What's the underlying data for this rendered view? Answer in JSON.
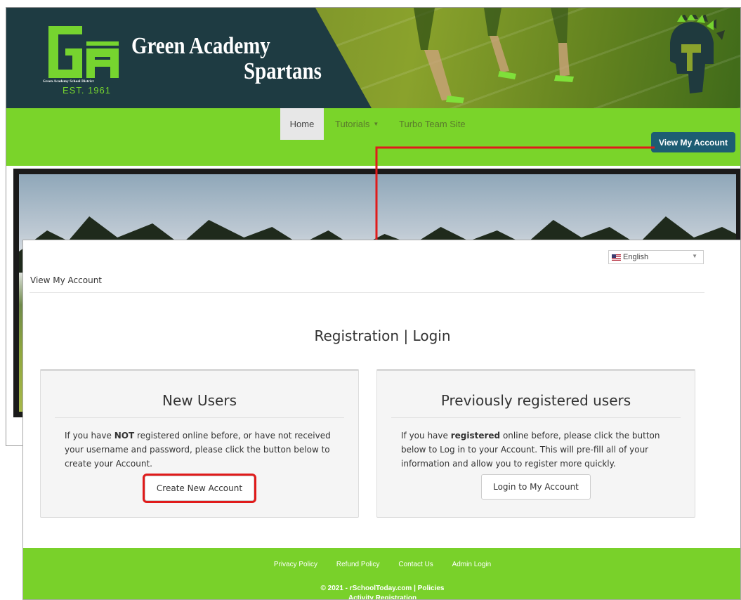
{
  "header": {
    "title_line1": "Green Academy",
    "title_line2": "Spartans",
    "logo_letters": "GA",
    "district": "Green Academy School District",
    "established": "EST. 1961"
  },
  "nav": {
    "home": "Home",
    "tutorials": "Tutorials",
    "turbo": "Turbo Team Site",
    "view_account": "View My Account"
  },
  "modal": {
    "language": "English",
    "breadcrumb": "View My Account",
    "heading": "Registration | Login"
  },
  "new_users": {
    "title": "New Users",
    "text_before": "If you have ",
    "text_bold": "NOT",
    "text_after": " registered online before, or have not received your username and password, please click the button below to create your Account.",
    "button": "Create New Account"
  },
  "prev_users": {
    "title": "Previously registered users",
    "text_before": "If you have ",
    "text_bold": "registered",
    "text_after": " online before, please click the button below to Log in to your Account. This will pre-fill all of your information and allow you to register more quickly.",
    "button": "Login to My Account"
  },
  "footer": {
    "links": [
      "Privacy Policy",
      "Refund Policy",
      "Contact Us",
      "Admin Login"
    ],
    "copyright": "© 2021 - rSchoolToday.com | Policies",
    "activity": "Activity Registration"
  },
  "colors": {
    "brand_green": "#7ad42a",
    "dark_teal": "#1e3b42",
    "button_blue": "#1d5d73",
    "highlight_red": "#e01b1b"
  },
  "icons": [
    "ga-logo",
    "spartan-helmet-icon",
    "us-flag-icon",
    "caret-down-icon"
  ]
}
